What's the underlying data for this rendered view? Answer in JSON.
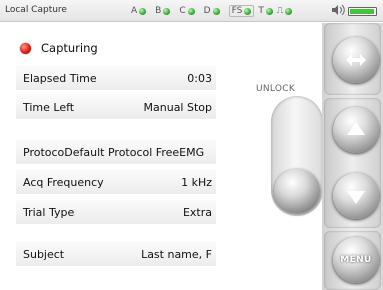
{
  "status_bar": {
    "title": "Local Capture",
    "indicators": [
      {
        "label": "A"
      },
      {
        "label": "B"
      },
      {
        "label": "C"
      },
      {
        "label": "D"
      },
      {
        "label": "FS"
      },
      {
        "label": "T"
      },
      {
        "label": "⎍"
      }
    ],
    "battery_level_percent": 95,
    "indicator_color": "#2faa2f"
  },
  "capture": {
    "state_label": "Capturing",
    "state_color": "#e01d12"
  },
  "fields": {
    "elapsed_time": {
      "label": "Elapsed Time",
      "value": "0:03"
    },
    "time_left": {
      "label": "Time Left",
      "value": "Manual Stop"
    },
    "protocol": {
      "label": "Protoco",
      "value": "Default Protocol FreeEMG"
    },
    "acq_frequency": {
      "label": "Acq Frequency",
      "value": "1 kHz"
    },
    "trial_type": {
      "label": "Trial Type",
      "value": "Extra"
    },
    "subject": {
      "label": "Subject",
      "value": "Last name, F"
    }
  },
  "unlock": {
    "label": "UNLOCK"
  },
  "side_buttons": {
    "top_icon": "switch-arrows-icon",
    "up_icon": "arrow-up-icon",
    "down_icon": "arrow-down-icon",
    "menu_label": "MENU"
  }
}
